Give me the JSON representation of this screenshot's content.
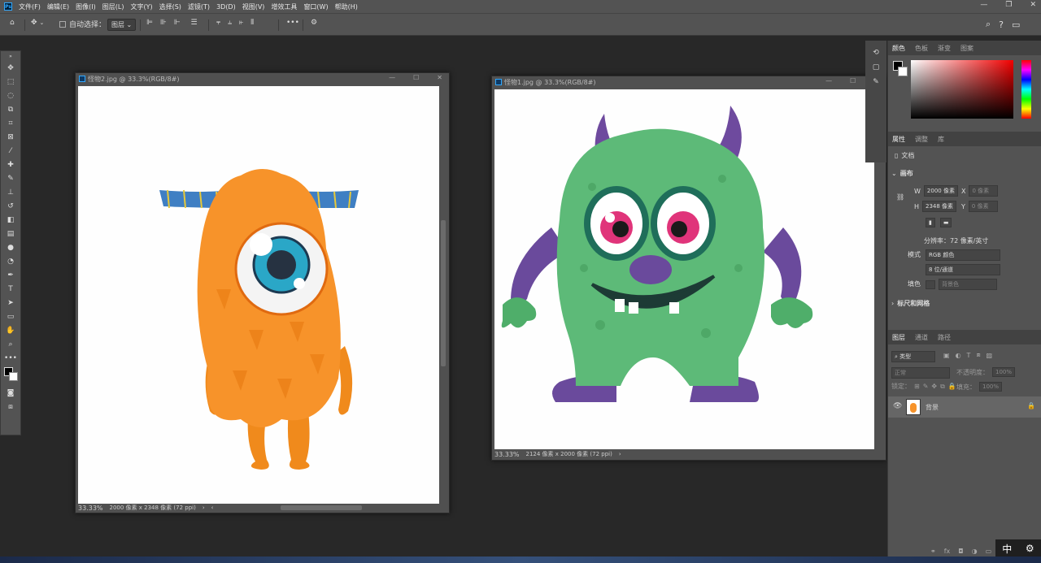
{
  "menu": [
    "文件(F)",
    "编辑(E)",
    "图像(I)",
    "图层(L)",
    "文字(Y)",
    "选择(S)",
    "滤镜(T)",
    "3D(D)",
    "视图(V)",
    "增效工具",
    "窗口(W)",
    "帮助(H)"
  ],
  "options": {
    "auto_select_label": "自动选择：",
    "auto_select_value": "图层"
  },
  "doc1": {
    "title": "怪物2.jpg @ 33.3%(RGB/8#)",
    "zoom": "33.33%",
    "info": "2000 像素 x 2348 像素 (72 ppi)"
  },
  "doc2": {
    "title": "怪物1.jpg @ 33.3%(RGB/8#)",
    "zoom": "33.33%",
    "info": "2124 像素 x 2000 像素 (72 ppi)"
  },
  "color_tabs": [
    "颜色",
    "色板",
    "渐变",
    "图案"
  ],
  "props_tabs": [
    "属性",
    "调整",
    "库"
  ],
  "props": {
    "doc_label": "文档",
    "canvas_label": "画布",
    "w_label": "W",
    "w_value": "2000 像素",
    "x_label": "X",
    "x_placeholder": "0 像素",
    "h_label": "H",
    "h_value": "2348 像素",
    "y_label": "Y",
    "y_placeholder": "0 像素",
    "resolution": "分辨率：72 像素/英寸",
    "mode_label": "模式",
    "mode_value": "RGB 颜色",
    "depth_value": "8 位/通道",
    "fill_label": "填色",
    "fill_value": "背景色",
    "rulers_label": "标尺和网格"
  },
  "layers_tabs": [
    "图层",
    "通道",
    "路径"
  ],
  "layers": {
    "kind": "类型",
    "blend": "正常",
    "opacity_label": "不透明度：",
    "opacity": "100%",
    "lock_label": "锁定：",
    "fill_label": "填充：",
    "fill": "100%",
    "layer_name": "背景"
  },
  "ime": {
    "lang": "中"
  }
}
